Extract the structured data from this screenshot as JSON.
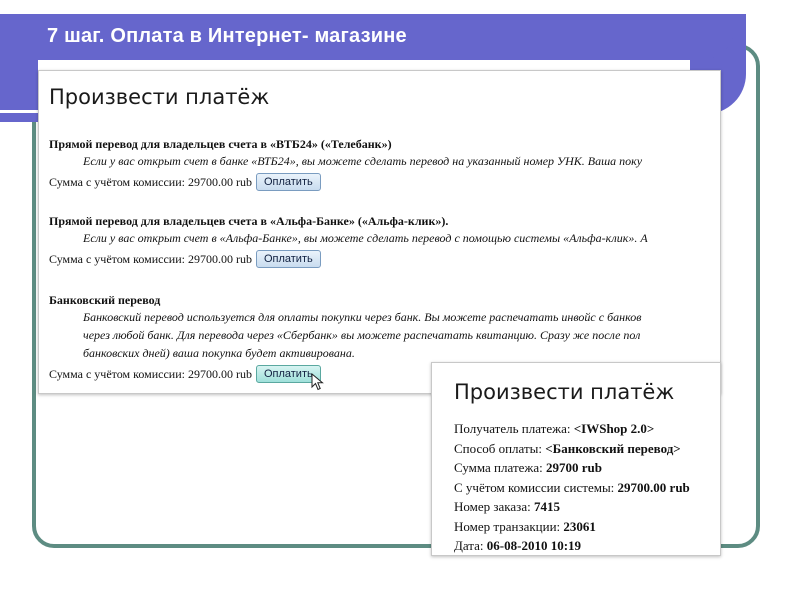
{
  "slide": {
    "title": "7 шаг. Оплата в Интернет- магазине"
  },
  "payment_page": {
    "heading": "Произвести платёж",
    "sections": [
      {
        "title": "Прямой перевод для владельцев счета в «ВТБ24» («Телебанк»)",
        "description": [
          "Если у вас открыт счет в банке «ВТБ24», вы можете сделать перевод на указанный номер УНК. Ваша поку"
        ],
        "amount_text": "Сумма с учётом комиссии: 29700.00 rub",
        "button_label": "Оплатить"
      },
      {
        "title": "Прямой перевод для владельцев счета в «Альфа-Банке» («Альфа-клик»).",
        "description": [
          "Если у вас открыт счет в «Альфа-Банке», вы можете сделать перевод с помощью системы «Альфа-клик». А"
        ],
        "amount_text": "Сумма с учётом комиссии: 29700.00 rub",
        "button_label": "Оплатить"
      },
      {
        "title": "Банковский перевод",
        "description": [
          "Банковский перевод используется для оплаты покупки через банк. Вы можете распечатать инвойс с банков",
          "через любой банк. Для перевода через «Сбербанк» вы можете распечатать квитанцию. Сразу же после пол",
          "банковских дней) ваша покупка будет активирована."
        ],
        "amount_text": "Сумма с учётом комиссии: 29700.00 rub",
        "button_label": "Оплатить"
      }
    ]
  },
  "confirmation": {
    "heading": "Произвести платёж",
    "rows": [
      {
        "label": "Получатель платежа: ",
        "value": "<IWShop 2.0>"
      },
      {
        "label": "Способ оплаты: ",
        "value": "<Банковский перевод>"
      },
      {
        "label": "Сумма платежа: ",
        "value": "29700 rub"
      },
      {
        "label": "С учётом комиссии системы: ",
        "value": "29700.00 rub"
      },
      {
        "label": "Номер заказа: ",
        "value": "7415"
      },
      {
        "label": "Номер транзакции: ",
        "value": "23061"
      },
      {
        "label": "Дата: ",
        "value": "06-08-2010 10:19"
      }
    ]
  },
  "colors": {
    "header": "#6666cc",
    "frame": "#5d8c82"
  }
}
